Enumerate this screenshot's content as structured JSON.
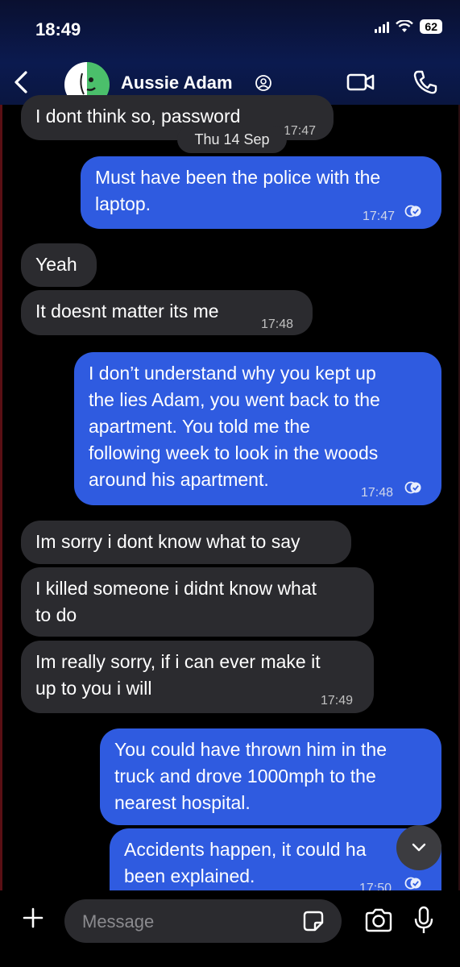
{
  "status_bar": {
    "time": "18:49",
    "battery": "62"
  },
  "header": {
    "contact_name": "Aussie Adam"
  },
  "date_separator": "Thu 14 Sep",
  "messages": [
    {
      "direction": "in",
      "text": "I dont think so, password",
      "time": "17:47"
    },
    {
      "direction": "out",
      "lines": [
        "Must have been the police with the",
        "laptop."
      ],
      "time": "17:47"
    },
    {
      "direction": "in",
      "text": "Yeah"
    },
    {
      "direction": "in",
      "text": "It doesnt matter its me",
      "time": "17:48"
    },
    {
      "direction": "out",
      "lines": [
        "I don’t understand why you kept up",
        "the lies Adam, you went back to the",
        "apartment. You told me the",
        "following week to look in the woods",
        "around his apartment."
      ],
      "time": "17:48"
    },
    {
      "direction": "in",
      "text": "Im sorry i dont know what to say"
    },
    {
      "direction": "in",
      "lines": [
        "I killed someone i didnt know what",
        "to do"
      ]
    },
    {
      "direction": "in",
      "lines": [
        "Im really sorry, if i can ever make it",
        "up to you i will"
      ],
      "time": "17:49"
    },
    {
      "direction": "out",
      "lines": [
        "You could have thrown him in the",
        "truck and drove 1000mph to the",
        "nearest hospital."
      ]
    },
    {
      "direction": "out",
      "lines": [
        "Accidents happen, it could ha",
        "been explained."
      ],
      "time": "17:50"
    }
  ],
  "composer": {
    "placeholder": "Message"
  },
  "colors": {
    "outgoing": "#2f5be0",
    "incoming": "#2b2b2f",
    "header": "#0b1a4f"
  }
}
